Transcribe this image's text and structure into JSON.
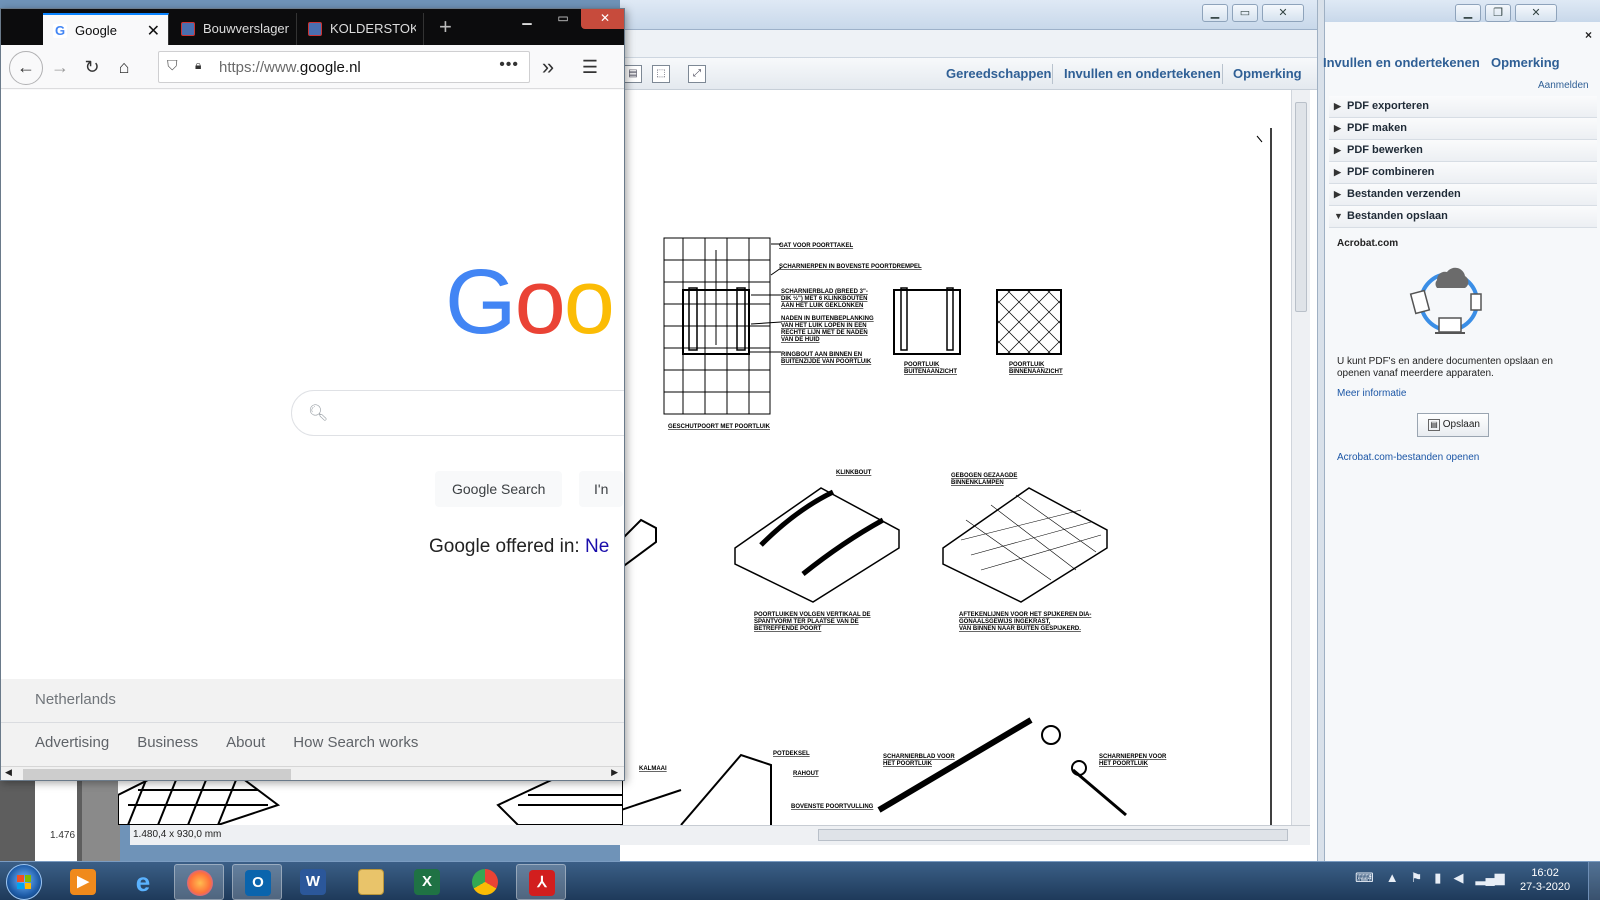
{
  "acrobat": {
    "tools_links": [
      "Gereedschappen",
      "Invullen en ondertekenen",
      "Opmerking"
    ],
    "close_glyph": "×",
    "status": {
      "page_size": "1.480,4 x 930,0 mm",
      "page_count_fragment": "1.476"
    }
  },
  "acrobat_pane": {
    "tabs": [
      "Invullen en ondertekenen",
      "Opmerking"
    ],
    "signin": "Aanmelden",
    "close_glyph": "×",
    "items": [
      "PDF exporteren",
      "PDF maken",
      "PDF bewerken",
      "PDF combineren",
      "Bestanden verzenden",
      "Bestanden opslaan"
    ],
    "section": {
      "title": "Acrobat.com",
      "text": "U kunt PDF's en andere documenten opslaan en openen vanaf meerdere apparaten.",
      "more": "Meer informatie",
      "button": "Opslaan",
      "open_link": "Acrobat.com-bestanden openen"
    }
  },
  "drawing_labels": {
    "gat": "GAT VOOR POORTTAKEL",
    "scharnierpen": "SCHARNIERPEN IN BOVENSTE POORTDREMPEL",
    "scharnierblad": "SCHARNIERBLAD (BREED 3\"-DIK ½\") MET 6 KLINKBOUTEN AAN HET LUIK GEKLONKEN",
    "naden": "NADEN IN BUITENBEPLANKING VAN HET LUIK LOPEN IN EEN RECHTE LIJN MET DE NADEN VAN DE HUID",
    "ringbout": "RINGBOUT AAN BINNEN EN BUITENZIJDE VAN POORTLUIK",
    "geschutpoort": "GESCHUTPOORT MET POORTLUIK",
    "buitenaanzicht": "POORTLUIK BUITENAANZICHT",
    "binnenaanzicht": "POORTLUIK BINNENAANZICHT",
    "klinkbout": "KLINKBOUT",
    "gebogen": "GEBOGEN GEZAAGDE BINNENKLAMPEN",
    "poortluiken": "POORTLUIKEN VOLGEN VERTIKAAL DE SPANTVORM TER PLAATSE VAN DE BETREFFENDE POORT",
    "aftekenlijnen": "AFTEKENLIJNEN VOOR HET SPIJKEREN DIAGONAALSGEWIJS INGEKRAST, VAN BINNEN NAAR BUITEN GESPIJKERD.",
    "potdeksel": "POTDEKSEL",
    "kalmaai": "KALMAAI",
    "rahout": "RAHOUT",
    "poortvulling": "BOVENSTE POORTVULLING",
    "scharnierblad_luik": "SCHARNIERBLAD VOOR HET POORTLUIK",
    "scharnierpen_luik": "SCHARNIERPEN VOOR HET POORTLUIK"
  },
  "firefox": {
    "tabs": [
      {
        "label": "Google",
        "favicon": "google-favicon",
        "active": true
      },
      {
        "label": "Bouwverslagen",
        "favicon": "site-favicon",
        "active": false
      },
      {
        "label": "KOLDERSTOK B",
        "favicon": "site-favicon",
        "active": false
      }
    ],
    "new_tab": "+",
    "url_prefix": "https://www.",
    "url_domain": "google.nl",
    "url_more": "•••",
    "overflow": "»",
    "menu": "☰"
  },
  "google": {
    "logo": "Goo",
    "search_button": "Google Search",
    "lucky_button_fragment": "I'n",
    "offered_label": "Google offered in:",
    "offered_lang": "Ne",
    "country": "Netherlands",
    "footer_links": [
      "Advertising",
      "Business",
      "About",
      "How Search works"
    ]
  },
  "taskbar": {
    "apps": [
      "media-player",
      "internet-explorer",
      "firefox",
      "outlook",
      "word",
      "file-explorer",
      "excel",
      "chrome",
      "acrobat"
    ],
    "time": "16:02",
    "date": "27-3-2020"
  },
  "colors": {
    "google_blue": "#4285f4",
    "google_red": "#ea4335",
    "google_yellow": "#fbbc05",
    "firefox_accent": "#0a84ff",
    "acrobat_link": "#2f5f95",
    "close_red": "#c74b3c"
  }
}
